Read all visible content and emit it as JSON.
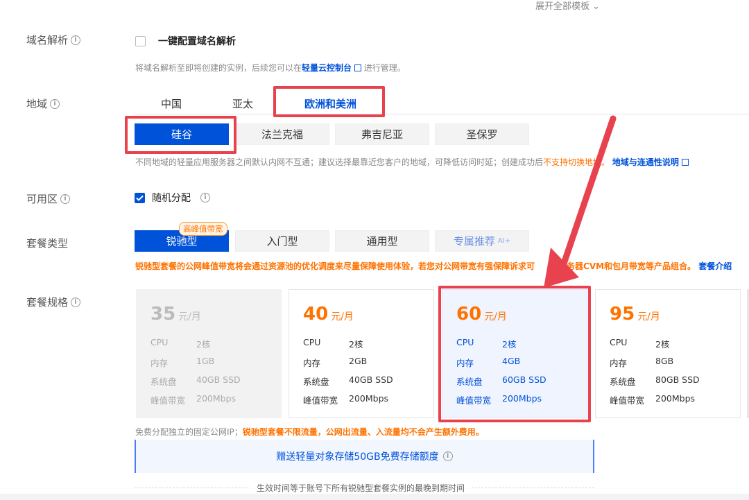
{
  "top": {
    "expand_templates": "展开全部模板"
  },
  "domain_resolution": {
    "label": "域名解析",
    "checkbox_label": "一键配置域名解析",
    "hint_prefix": "将域名解析至即将创建的实例，后续您可以在",
    "hint_link": "轻量云控制台",
    "hint_suffix": "进行管理。"
  },
  "region": {
    "label": "地域",
    "tabs": [
      {
        "label": "中国",
        "active": false
      },
      {
        "label": "亚太",
        "active": false
      },
      {
        "label": "欧洲和美洲",
        "active": true
      }
    ],
    "cities": [
      {
        "label": "硅谷",
        "active": true
      },
      {
        "label": "法兰克福",
        "active": false
      },
      {
        "label": "弗吉尼亚",
        "active": false
      },
      {
        "label": "圣保罗",
        "active": false
      }
    ],
    "hint_prefix": "不同地域的轻量应用服务器之间默认内网不互通；建议选择最靠近您客户的地域，可降低访问时延；创建成功后",
    "hint_warning": "不支持切换地域。",
    "hint_link": "地域与连通性说明"
  },
  "zone": {
    "label": "可用区",
    "option_label": "随机分配",
    "checked": true
  },
  "plan_type": {
    "label": "套餐类型",
    "badge": "高峰值带宽",
    "options": [
      {
        "label": "锐驰型",
        "active": true
      },
      {
        "label": "入门型",
        "active": false
      },
      {
        "label": "通用型",
        "active": false
      },
      {
        "label": "专属推荐",
        "ai": "AI+",
        "active": false
      }
    ],
    "hint_orange": "锐驰型套餐的公网峰值带宽将会通过资源池的优化调度来尽量保障使用体验，若您对公网带宽有强保障诉求可",
    "hint_orange_tail": "云服务器CVM和包月带宽等产品组合。",
    "hint_link": "套餐介绍"
  },
  "plan_spec": {
    "label": "套餐规格",
    "unit": "元/月",
    "spec_keys": [
      "CPU",
      "内存",
      "系统盘",
      "峰值带宽"
    ],
    "cards": [
      {
        "price": "35",
        "state": "disabled",
        "values": [
          "2核",
          "1GB",
          "40GB SSD",
          "200Mbps"
        ]
      },
      {
        "price": "40",
        "state": "normal",
        "values": [
          "2核",
          "2GB",
          "40GB SSD",
          "200Mbps"
        ]
      },
      {
        "price": "60",
        "state": "selected",
        "values": [
          "2核",
          "4GB",
          "60GB SSD",
          "200Mbps"
        ]
      },
      {
        "price": "95",
        "state": "normal",
        "values": [
          "2核",
          "8GB",
          "80GB SSD",
          "200Mbps"
        ]
      }
    ],
    "footnote_prefix": "免费分配独立的固定公网IP；",
    "footnote_orange": "锐驰型套餐不限流量，公网出流量、入流量均不会产生额外费用。",
    "banner": "赠送轻量对象存储50GB免费存储额度",
    "bottom_note": "生效时间等于账号下所有锐驰型套餐实例的最晚到期时间"
  },
  "colors": {
    "primary": "#0052d9",
    "accent": "#ff7200",
    "highlight": "#e8424f"
  }
}
